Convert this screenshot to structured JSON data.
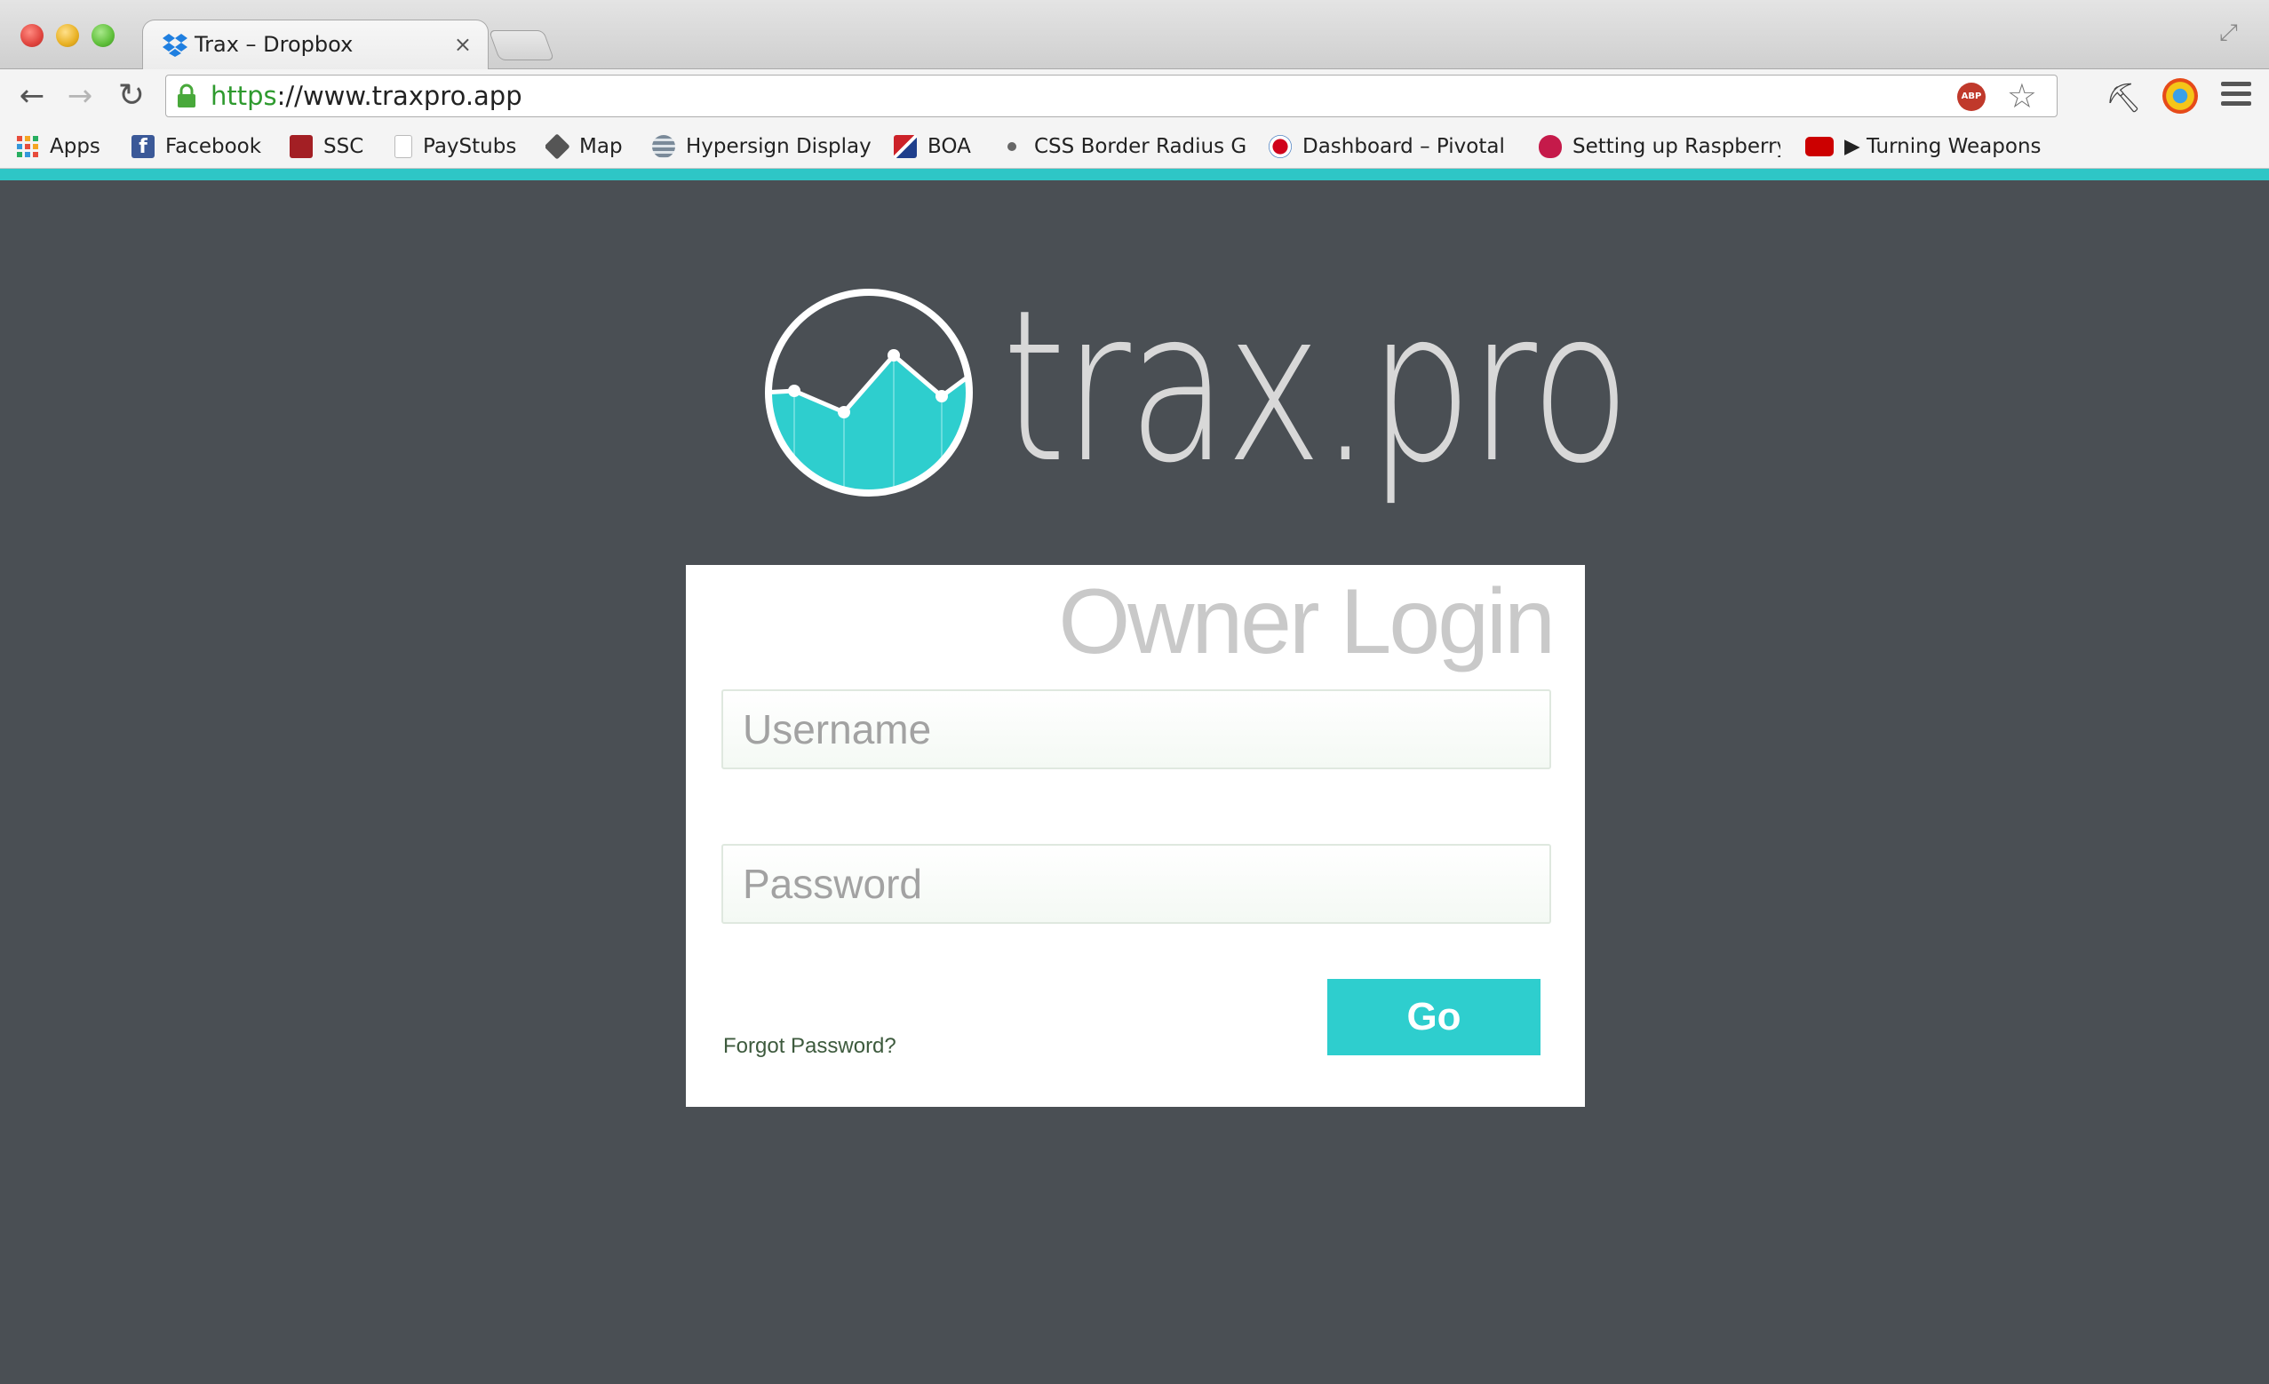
{
  "browser": {
    "tab_title": "Trax – Dropbox",
    "tab_close": "×",
    "url_scheme": "https",
    "url_rest": "://www.traxpro.app",
    "abp_label": "ABP"
  },
  "bookmarks": [
    {
      "label": "Apps",
      "icon": "apps-grid-icon",
      "color": "#e74c3c"
    },
    {
      "label": "Facebook",
      "icon": "facebook-icon",
      "color": "#3b5998"
    },
    {
      "label": "SSC",
      "icon": "ssc-icon",
      "color": "#a31f24"
    },
    {
      "label": "PayStubs",
      "icon": "document-icon",
      "color": "#ffffff"
    },
    {
      "label": "Map",
      "icon": "cube-icon",
      "color": "#555555"
    },
    {
      "label": "Hypersign Display",
      "icon": "stack-icon",
      "color": "#7a8a99"
    },
    {
      "label": "BOA",
      "icon": "boa-icon",
      "color": "#cc2229"
    },
    {
      "label": "CSS Border Radius G",
      "icon": "dot-icon",
      "color": "#666666"
    },
    {
      "label": "Dashboard – Pivotal",
      "icon": "pivotal-icon",
      "color": "#d0021b"
    },
    {
      "label": "Setting up Raspberry",
      "icon": "raspberry-icon",
      "color": "#c51a4a"
    },
    {
      "label": "▶ Turning Weapons",
      "icon": "youtube-icon",
      "color": "#cc0000"
    }
  ],
  "brand": {
    "logo_text": "trax.pro",
    "accent": "#2ecece",
    "background": "#4a4f54"
  },
  "login": {
    "title": "Owner Login",
    "username_placeholder": "Username",
    "password_placeholder": "Password",
    "forgot_label": "Forgot Password?",
    "go_label": "Go"
  }
}
